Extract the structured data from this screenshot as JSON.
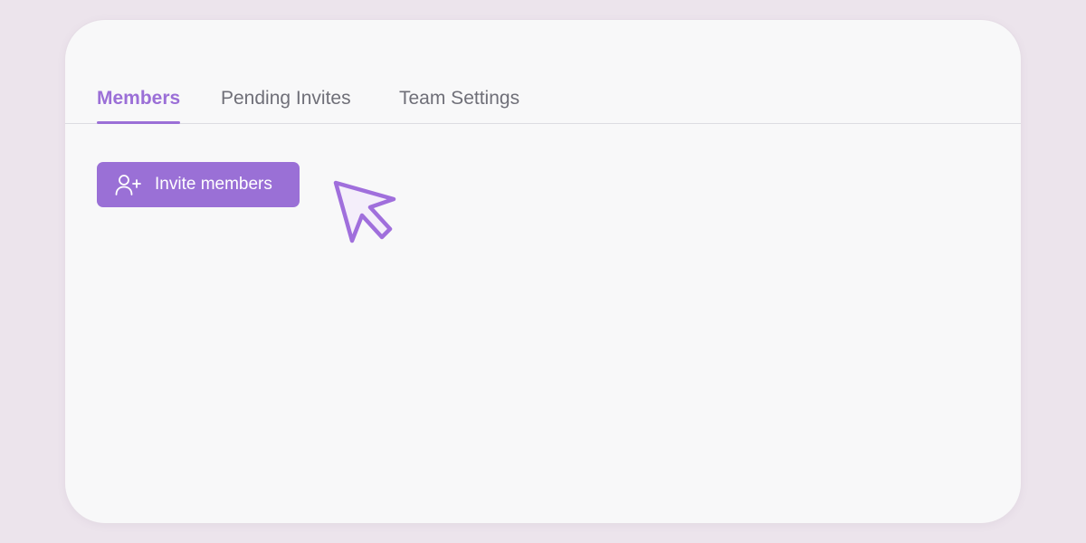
{
  "tabs": [
    {
      "label": "Members",
      "active": true
    },
    {
      "label": "Pending Invites",
      "active": false
    },
    {
      "label": "Team Settings",
      "active": false
    }
  ],
  "invite_button": {
    "label": "Invite members",
    "icon": "user-plus-icon"
  },
  "cursor": {
    "icon": "mouse-pointer-icon"
  },
  "colors": {
    "accent": "#9b6fd7",
    "page_background": "#ece4ec",
    "card_background": "#f8f8f9",
    "inactive_tab_text": "#6f6f78"
  }
}
